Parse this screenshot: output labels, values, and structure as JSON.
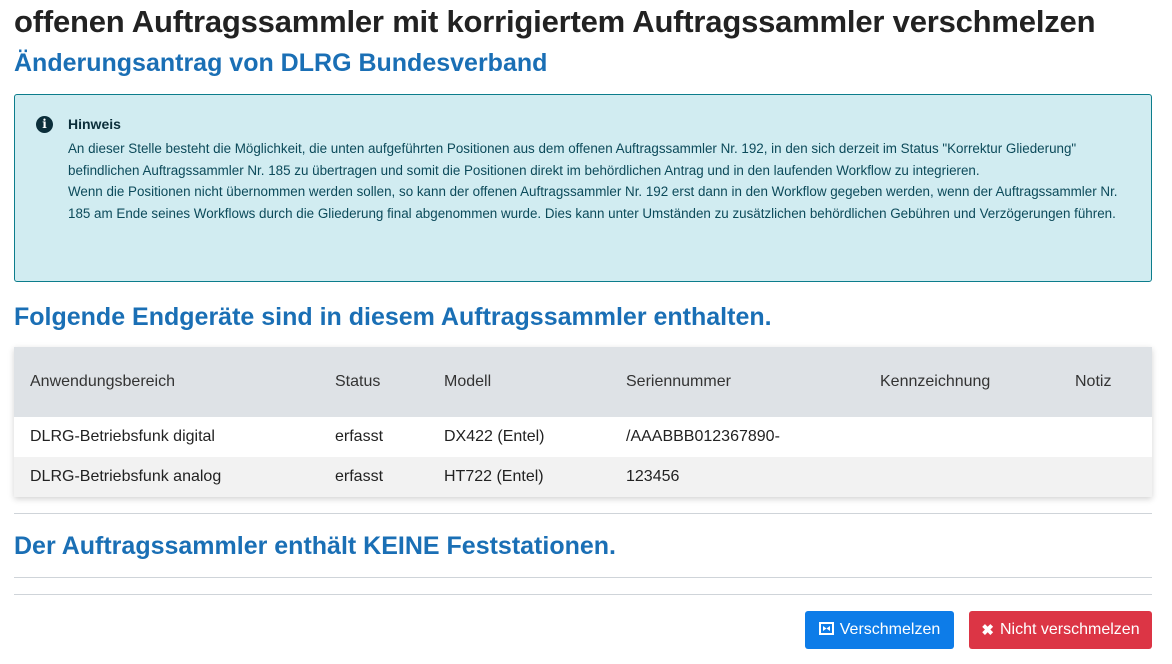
{
  "page": {
    "title": "offenen Auftragssammler mit korrigiertem Auftragssammler verschmelzen",
    "subtitle": "Änderungsantrag von DLRG Bundesverband"
  },
  "hint": {
    "icon": "info-icon",
    "heading": "Hinweis",
    "paragraph1": "An dieser Stelle besteht die Möglichkeit, die unten aufgeführten Positionen aus dem offenen Auftragssammler Nr. 192, in den sich derzeit im Status \"Korrektur Gliederung\" befindlichen Auftragssammler Nr. 185 zu übertragen und somit die Positionen direkt im behördlichen Antrag und in den laufenden Workflow zu integrieren.",
    "paragraph2": "Wenn die Positionen nicht übernommen werden sollen, so kann der offenen Auftragssammler Nr. 192 erst dann in den Workflow gegeben werden, wenn der Auftragssammler Nr. 185 am Ende seines Workflows durch die Gliederung final abgenommen wurde. Dies kann unter Umständen zu zusätzlichen behördlichen Gebühren und Verzögerungen führen."
  },
  "devices": {
    "heading": "Folgende Endgeräte sind in diesem Auftragssammler enthalten.",
    "columns": [
      "Anwendungsbereich",
      "Status",
      "Modell",
      "Seriennummer",
      "Kennzeichnung",
      "Notiz"
    ],
    "rows": [
      [
        "DLRG-Betriebsfunk digital",
        "erfasst",
        "DX422 (Entel)",
        "/AAABBB012367890-",
        "",
        ""
      ],
      [
        "DLRG-Betriebsfunk analog",
        "erfasst",
        "HT722 (Entel)",
        "123456",
        "",
        ""
      ]
    ]
  },
  "stations": {
    "heading": "Der Auftragssammler enthält KEINE Feststationen."
  },
  "actions": {
    "merge_label": "Verschmelzen",
    "merge_icon": "merge-icon",
    "no_merge_label": "Nicht verschmelzen",
    "no_merge_icon": "close-icon"
  },
  "colors": {
    "heading_blue": "#1a6fb5",
    "info_bg": "#d1ecf1",
    "primary": "#0d7ce8",
    "danger": "#dc3545"
  }
}
